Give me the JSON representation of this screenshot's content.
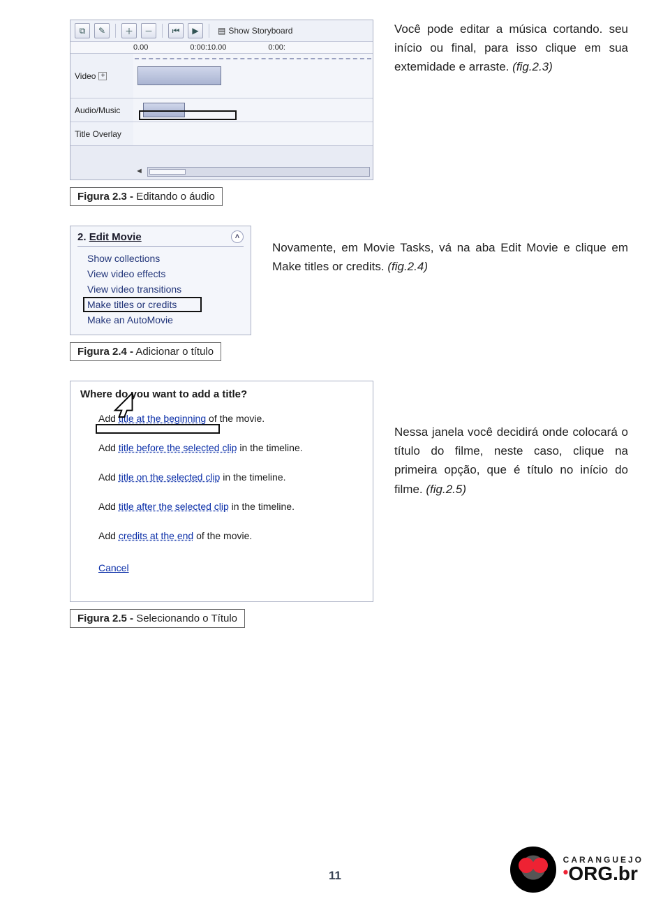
{
  "section1": {
    "paragraph": "Você pode editar a música cortando. seu início ou final, para isso clique em sua extemidade e arraste.",
    "fig_ref": "(fig.2.3)",
    "caption_bold": "Figura 2.3 -",
    "caption_rest": " Editando o áudio"
  },
  "timeline": {
    "storyboard_label": "Show Storyboard",
    "ruler": [
      "0.00",
      "0:00:10.00",
      "0:00:"
    ],
    "track_video": "Video",
    "track_audio": "Audio/Music",
    "track_title": "Title Overlay"
  },
  "section2": {
    "paragraph": "Novamente, em Movie Tasks, vá na aba Edit Movie e clique em Make titles or credits.",
    "fig_ref": "(fig.2.4)",
    "caption_bold": "Figura 2.4 -",
    "caption_rest": " Adicionar o título"
  },
  "taskpane": {
    "heading_num": "2.",
    "heading_label": "Edit Movie",
    "items": [
      "Show collections",
      "View video effects",
      "View video transitions",
      "Make titles or credits",
      "Make an AutoMovie"
    ]
  },
  "section3": {
    "paragraph": "Nessa janela você decidirá onde colocará o título do filme, neste caso, clique na primeira opção, que é título no início do filme.",
    "fig_ref": "(fig.2.5)",
    "caption_bold": "Figura 2.5 -",
    "caption_rest": " Selecionando o Título"
  },
  "wizard": {
    "heading": "Where do you want to add a title?",
    "opt1_pre": "Add ",
    "opt1_link": "title at the beginning",
    "opt1_post": " of the movie.",
    "opt2_pre": "Add ",
    "opt2_link": "title before the selected clip",
    "opt2_post": " in the timeline.",
    "opt3_pre": "Add ",
    "opt3_link": "title on the selected clip",
    "opt3_post": " in the timeline.",
    "opt4_pre": "Add ",
    "opt4_link": "title after the selected clip",
    "opt4_post": " in the timeline.",
    "opt5_pre": "Add ",
    "opt5_link": "credits at the end",
    "opt5_post": " of the movie.",
    "cancel": "Cancel"
  },
  "footer": {
    "page_number": "11",
    "brand_small": "CARANGUEJO",
    "brand_big": "ORG.br"
  }
}
